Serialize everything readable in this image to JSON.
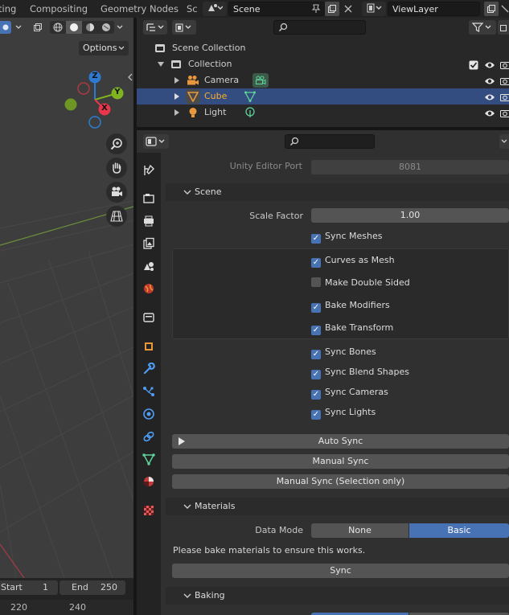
{
  "workspace_tabs": [
    "ting",
    "Compositing",
    "Geometry Nodes",
    "Sc"
  ],
  "scene_name": "Scene",
  "view_layer_name": "ViewLayer",
  "viewport": {
    "options_label": "Options",
    "axes": {
      "z": "Z",
      "y": "Y",
      "x": "X"
    },
    "colors": {
      "x": "#e8364b",
      "y": "#7fb41e",
      "z": "#2f7ad1"
    }
  },
  "timeline": {
    "start_label": "Start",
    "start_value": "1",
    "end_label": "End",
    "end_value": "250",
    "ticks": [
      "220",
      "240"
    ]
  },
  "outliner": {
    "root": "Scene Collection",
    "collection": "Collection",
    "items": [
      {
        "name": "Camera",
        "icon": "camera-icon"
      },
      {
        "name": "Cube",
        "icon": "mesh-icon",
        "selected": true
      },
      {
        "name": "Light",
        "icon": "light-icon"
      }
    ]
  },
  "properties": {
    "unity_port_label": "Unity Editor Port",
    "unity_port_value": "8081",
    "scene_panel": "Scene",
    "scale_factor_label": "Scale Factor",
    "scale_factor_value": "1.00",
    "sync_meshes": "Sync Meshes",
    "mesh_options": [
      {
        "label": "Curves as Mesh",
        "checked": true
      },
      {
        "label": "Make Double Sided",
        "checked": false
      },
      {
        "label": "Bake Modifiers",
        "checked": true
      },
      {
        "label": "Bake Transform",
        "checked": true
      }
    ],
    "sync_options": [
      {
        "label": "Sync Bones",
        "checked": true
      },
      {
        "label": "Sync Blend Shapes",
        "checked": true
      },
      {
        "label": "Sync Cameras",
        "checked": true
      },
      {
        "label": "Sync Lights",
        "checked": true
      }
    ],
    "auto_sync": "Auto Sync",
    "manual_sync": "Manual Sync",
    "manual_sync_selection": "Manual Sync (Selection only)",
    "materials_panel": "Materials",
    "data_mode_label": "Data Mode",
    "data_mode_options": [
      "None",
      "Basic"
    ],
    "data_mode_selected": "Basic",
    "bake_note": "Please bake materials to ensure this works.",
    "sync_button": "Sync",
    "baking_panel": "Baking"
  }
}
